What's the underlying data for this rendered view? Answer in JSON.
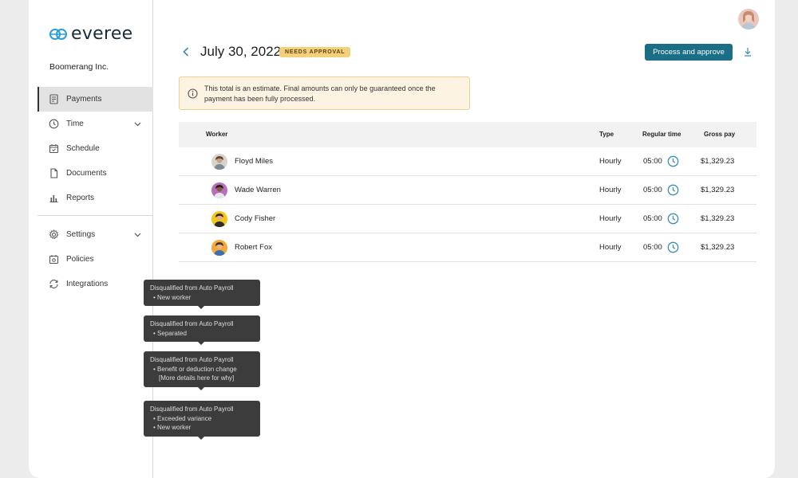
{
  "brand": {
    "name": "everee",
    "color": "#2a9ed6"
  },
  "company": "Boomerang Inc.",
  "sidebar": {
    "items": [
      {
        "label": "Payments",
        "icon": "receipt-icon",
        "active": true
      },
      {
        "label": "Time",
        "icon": "clock-icon",
        "expandable": true
      },
      {
        "label": "Schedule",
        "icon": "calendar-icon"
      },
      {
        "label": "Documents",
        "icon": "document-icon"
      },
      {
        "label": "Reports",
        "icon": "bar-chart-icon"
      }
    ],
    "items2": [
      {
        "label": "Settings",
        "icon": "gear-icon",
        "expandable": true
      },
      {
        "label": "Policies",
        "icon": "policy-icon"
      },
      {
        "label": "Integrations",
        "icon": "sync-icon"
      }
    ]
  },
  "tooltips": [
    {
      "title": "Disqualified from Auto Payroll",
      "items": [
        "New worker"
      ]
    },
    {
      "title": "Disqualified from Auto Payroll",
      "items": [
        "Separated"
      ]
    },
    {
      "title": "Disqualified from Auto Payroll",
      "items": [
        "Benefit or deduction change"
      ],
      "sub": "[More details here for why]"
    },
    {
      "title": "Disqualified from Auto Payroll",
      "items": [
        "Exceeded variance",
        "New worker"
      ]
    }
  ],
  "header": {
    "title": "July 30, 2022",
    "badge": "NEEDS APPROVAL",
    "primary_action": "Process and approve"
  },
  "notice": "This total is an estimate. Final amounts can only be guaranteed once the payment has been fully processed.",
  "table": {
    "columns": [
      "Worker",
      "Type",
      "Regular time",
      "Gross pay"
    ],
    "rows": [
      {
        "worker": "Floyd Miles",
        "type": "Hourly",
        "regular_time": "05:00",
        "gross_pay": "$1,329.23"
      },
      {
        "worker": "Wade Warren",
        "type": "Hourly",
        "regular_time": "05:00",
        "gross_pay": "$1,329.23"
      },
      {
        "worker": "Cody Fisher",
        "type": "Hourly",
        "regular_time": "05:00",
        "gross_pay": "$1,329.23"
      },
      {
        "worker": "Robert Fox",
        "type": "Hourly",
        "regular_time": "05:00",
        "gross_pay": "$1,329.23"
      }
    ]
  },
  "colors": {
    "accent": "#1a6e86",
    "link": "#3a8db0",
    "badge": "#f4cf7c",
    "notice_bg": "#fdf3e3"
  }
}
